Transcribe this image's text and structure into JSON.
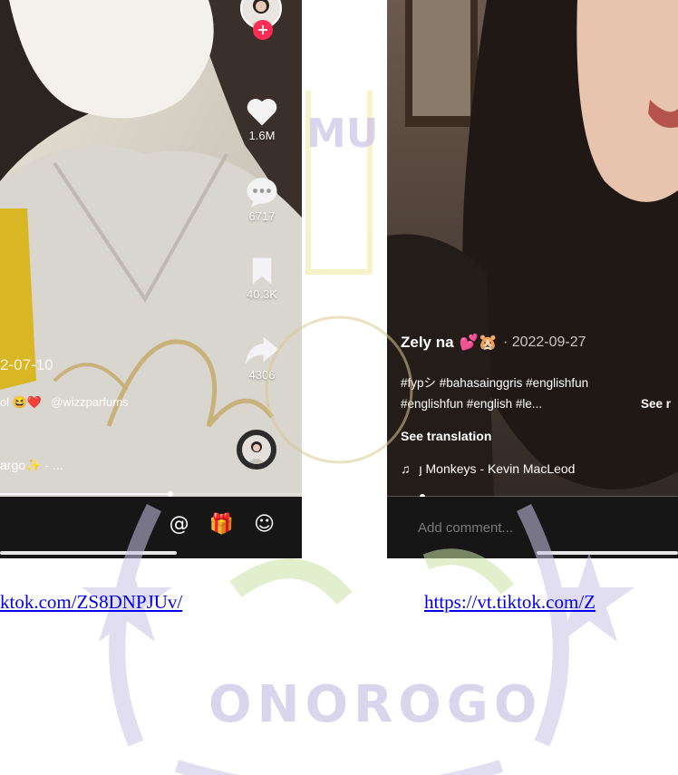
{
  "left_video": {
    "rail": {
      "likes": "1.6M",
      "comments": "6717",
      "bookmarks": "40.3K",
      "shares": "4306"
    },
    "date_fragment": "2-07-10",
    "caption_fragment": "ol 😆❤️",
    "mention": "@wizzparfums",
    "music_fragment": "argo✨ - ...",
    "bottom_icons": [
      "@",
      "🎁",
      "☺"
    ]
  },
  "right_video": {
    "author": "Zely na",
    "author_emojis": "💕🐹",
    "date": "· 2022-09-27",
    "hashtags_line1": "#fypシ #bahasainggris #englishfun",
    "hashtags_line2": "#englishfun #english #le...",
    "see_more": "See r",
    "see_translation": "See translation",
    "music_icon": "♫",
    "music": "ȷ Monkeys - Kevin MacLeod",
    "comment_placeholder": "Add comment..."
  },
  "links": {
    "left": "ktok.com/ZS8DNPJUv/",
    "right": "https://vt.tiktok.com/Z"
  },
  "watermark": {
    "top_text": "MU",
    "bottom_text": "ONOROGO"
  },
  "colors": {
    "tiktok_red": "#fe2c55",
    "link_blue": "#0000ee",
    "watermark_purple": "#c9c4e6",
    "watermark_yellow": "#f3e9a0"
  }
}
